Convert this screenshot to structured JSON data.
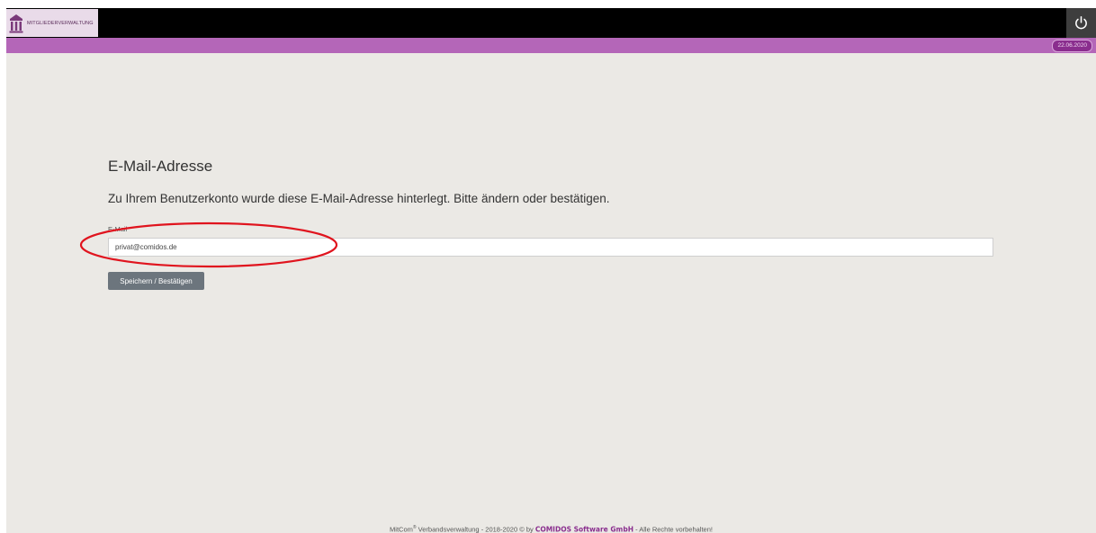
{
  "header": {
    "logo_text": "MITGLIEDERVERWALTUNG",
    "date": "22.06.2020"
  },
  "main": {
    "title": "E-Mail-Adresse",
    "intro": "Zu Ihrem Benutzerkonto wurde diese E-Mail-Adresse hinterlegt. Bitte ändern oder bestätigen.",
    "email_label": "E-Mail",
    "email_value": "privat@comidos.de",
    "save_label": "Speichern / Bestätigen"
  },
  "footer": {
    "product": "MitCom",
    "registered": "®",
    "text": " Verbandsverwaltung -  2018-2020 © by ",
    "company": "COMIDOS Software GmbH",
    "suffix": " - Alle Rechte vorbehalten!"
  },
  "colors": {
    "accent": "#b466b8",
    "brand_dark": "#8a2e8e",
    "annotation": "#e0141e"
  },
  "icons": {
    "logo": "building-columns-icon",
    "power": "power-icon"
  }
}
